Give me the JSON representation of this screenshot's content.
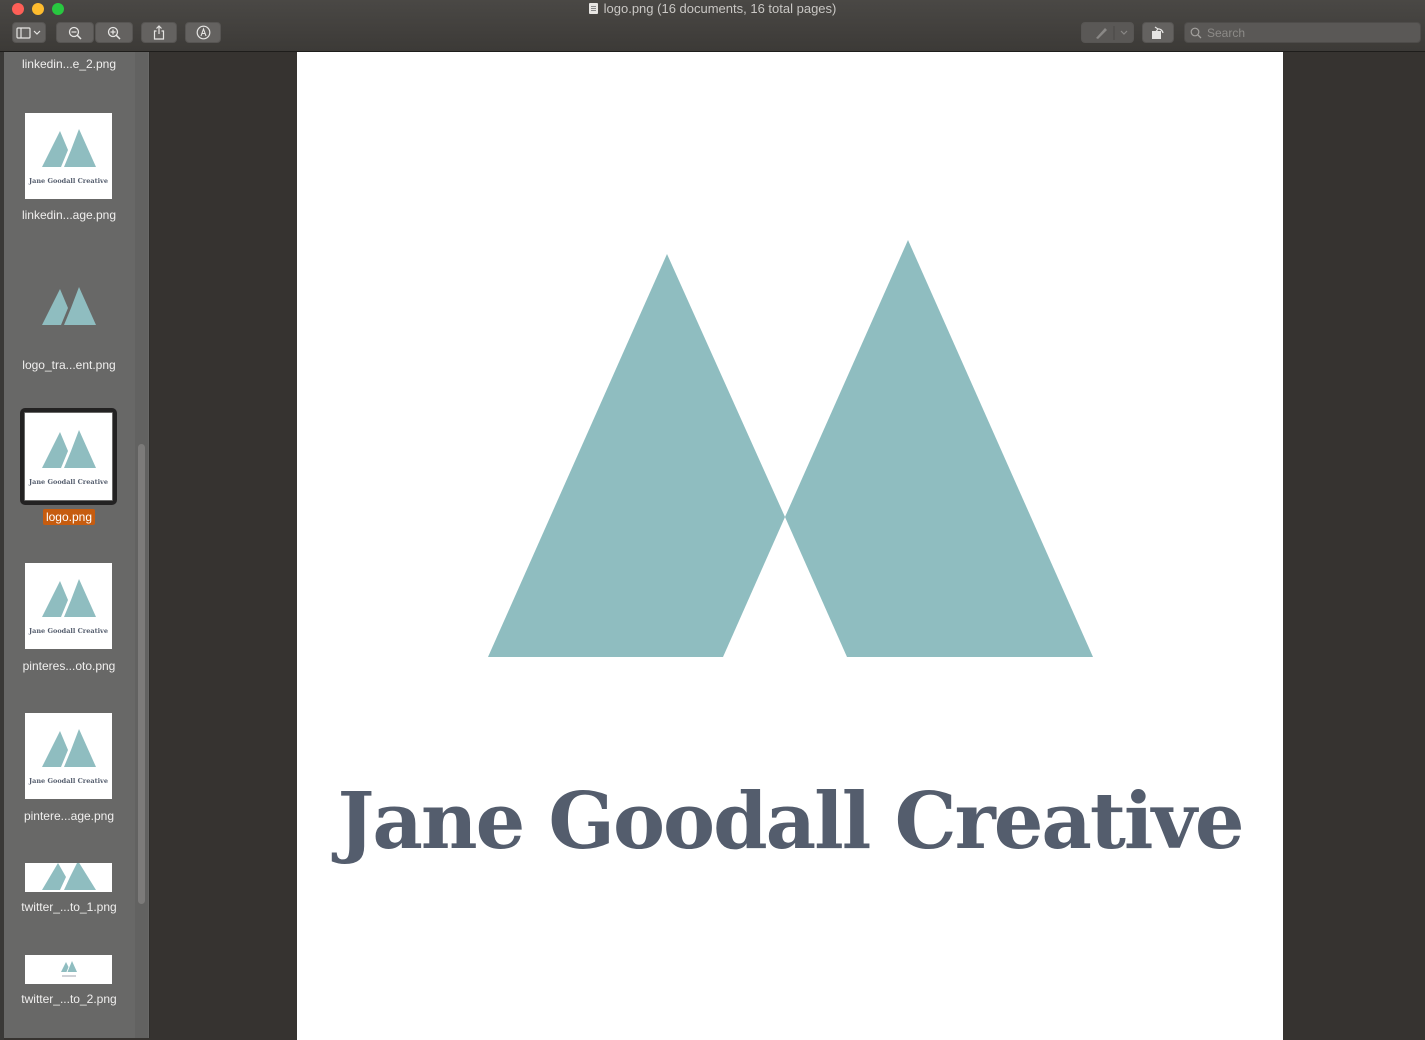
{
  "window": {
    "title": "logo.png (16 documents, 16 total pages)"
  },
  "toolbar": {
    "search_placeholder": "Search"
  },
  "sidebar": {
    "items": [
      {
        "label": "linkedin...e_2.png",
        "selected": false
      },
      {
        "label": "linkedin...age.png",
        "selected": false
      },
      {
        "label": "logo_tra...ent.png",
        "selected": false
      },
      {
        "label": "logo.png",
        "selected": true
      },
      {
        "label": "pinteres...oto.png",
        "selected": false
      },
      {
        "label": "pintere...age.png",
        "selected": false
      },
      {
        "label": "twitter_...to_1.png",
        "selected": false
      },
      {
        "label": "twitter_...to_2.png",
        "selected": false
      }
    ]
  },
  "document": {
    "logo_text": "Jane Goodall Creative",
    "logo_color": "#8fbdc0",
    "text_color": "#545d6d",
    "selection_color": "#c65c0f"
  }
}
